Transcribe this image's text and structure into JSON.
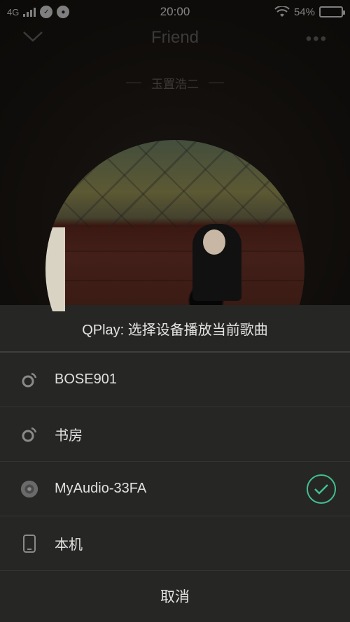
{
  "status": {
    "network": "4G",
    "time": "20:00",
    "battery": "54%"
  },
  "player": {
    "title": "Friend",
    "artist": "玉置浩二"
  },
  "sheet": {
    "title": "QPlay: 选择设备播放当前歌曲",
    "devices": [
      {
        "label": "BOSE901",
        "icon": "wireless-speaker-icon",
        "selected": false
      },
      {
        "label": "书房",
        "icon": "wireless-speaker-icon",
        "selected": false
      },
      {
        "label": "MyAudio-33FA",
        "icon": "speaker-icon",
        "selected": true
      },
      {
        "label": "本机",
        "icon": "phone-icon",
        "selected": false
      }
    ],
    "cancel_label": "取消"
  },
  "colors": {
    "accent": "#43bf8e",
    "sheet_bg": "#262625"
  }
}
